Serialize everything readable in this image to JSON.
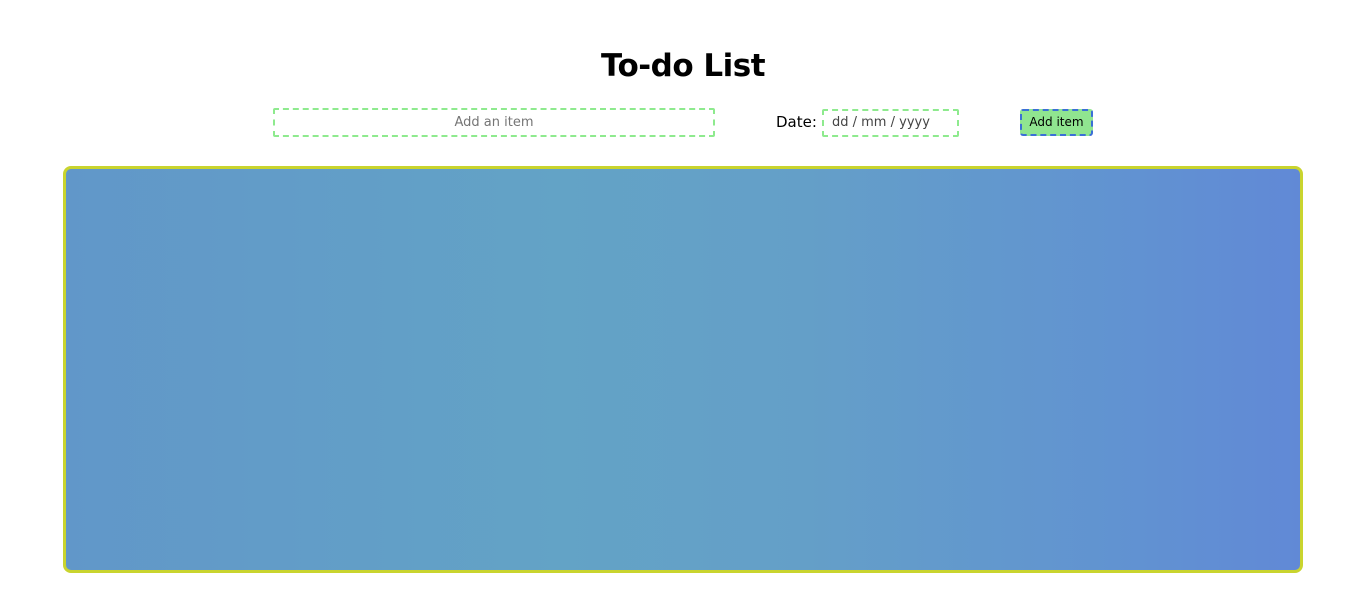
{
  "page": {
    "title": "To-do List"
  },
  "form": {
    "item_placeholder": "Add an item",
    "date_label": "Date:",
    "date_placeholder": "dd / mm / yyyy",
    "add_button_label": "Add item"
  },
  "list": {
    "items": []
  },
  "colors": {
    "input_border": "#8eea8e",
    "button_background": "#90e590",
    "button_border": "#3b6fd6",
    "panel_border": "#c9d42e",
    "panel_gradient_start": "#6197c9",
    "panel_gradient_end": "#6189d6"
  }
}
